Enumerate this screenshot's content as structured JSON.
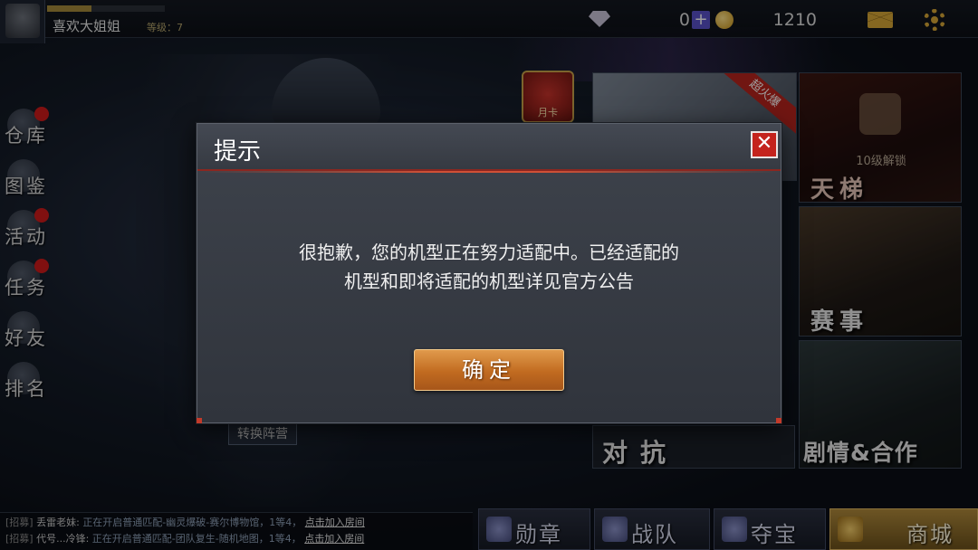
{
  "player": {
    "name": "喜欢大姐姐",
    "level_text": "等级：7",
    "xp_progress": 0.38
  },
  "currency": {
    "diamonds": "0",
    "plus": "+",
    "coins": "1210"
  },
  "icons": {
    "diamond": "diamond-icon",
    "coin": "coin-icon",
    "mail": "mail-icon",
    "settings": "gear-icon",
    "close": "close-icon"
  },
  "left_menu": [
    {
      "label": "仓库",
      "badge": true
    },
    {
      "label": "图鉴",
      "badge": false
    },
    {
      "label": "活动",
      "badge": true
    },
    {
      "label": "任务",
      "badge": true
    },
    {
      "label": "好友",
      "badge": false
    },
    {
      "label": "排名",
      "badge": false
    }
  ],
  "month_card": "月卡",
  "tiles": {
    "banner_ribbon": "超火爆",
    "ladder_lock": "10级解锁",
    "ladder": "天梯",
    "match": "赛事",
    "story": "剧情&合作",
    "versus": "对抗",
    "switch_camp": "转换阵营"
  },
  "chat": [
    {
      "tag": "[招募]",
      "name": "丢雷老妹:",
      "text": "正在开启普通匹配-幽灵爆破-赛尔博物馆，1等4，",
      "link": "点击加入房间"
    },
    {
      "tag": "[招募]",
      "name": "代号...冷锋:",
      "text": "正在开启普通匹配-团队复生-随机地图，1等4，",
      "link": "点击加入房间"
    }
  ],
  "nav": {
    "medal": "勋章",
    "team": "战队",
    "loot": "夺宝",
    "shop": "商城"
  },
  "modal": {
    "title": "提示",
    "close": "✕",
    "message_line1": "很抱歉，您的机型正在努力适配中。已经适配的",
    "message_line2": "机型和即将适配的机型详见官方公告",
    "confirm": "确定"
  },
  "colors": {
    "accent_red": "#c4231d",
    "confirm_orange": "#c16b20",
    "gold": "#d7a636"
  }
}
